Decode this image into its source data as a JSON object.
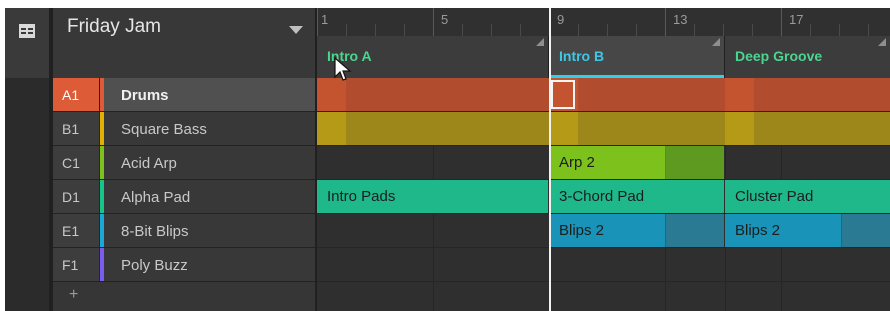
{
  "project": {
    "title": "Friday Jam"
  },
  "ruler": {
    "bars": [
      "1",
      "5",
      "9",
      "13",
      "17"
    ]
  },
  "sections": [
    {
      "label": "Intro A",
      "active": false
    },
    {
      "label": "Intro B",
      "active": true
    },
    {
      "label": "Deep Groove",
      "active": false
    }
  ],
  "tracks": [
    {
      "slot": "A1",
      "name": "Drums",
      "color": "#dd5b36",
      "selected": true
    },
    {
      "slot": "B1",
      "name": "Square Bass",
      "color": "#e2b000",
      "selected": false
    },
    {
      "slot": "C1",
      "name": "Acid Arp",
      "color": "#7dc21c",
      "selected": false
    },
    {
      "slot": "D1",
      "name": "Alpha Pad",
      "color": "#17c48a",
      "selected": false
    },
    {
      "slot": "E1",
      "name": "8-Bit Blips",
      "color": "#1aa8d6",
      "selected": false
    },
    {
      "slot": "F1",
      "name": "Poly Buzz",
      "color": "#7b5cf0",
      "selected": false
    }
  ],
  "add_track": {
    "label": "+"
  },
  "patterns": {
    "arp": {
      "label": "Arp 2"
    },
    "pad_intro": {
      "label": "Intro Pads"
    },
    "pad_chord": {
      "label": "3-Chord Pad"
    },
    "pad_cluster": {
      "label": "Cluster Pad"
    },
    "blips_b": {
      "label": "Blips 2"
    },
    "blips_c": {
      "label": "Blips 2"
    }
  },
  "colors": {
    "drums": "#c4532f",
    "bass": "#b59a17",
    "arp": "#7dc21c",
    "pad": "#1eb88a",
    "blips": "#1a93b8",
    "accent_cyan": "#2ed0f0",
    "section_green": "#49d68e"
  },
  "icons": {
    "menu": "grid-layout-icon",
    "caret": "chevron-down-icon",
    "cursor": "mouse-pointer-icon"
  }
}
